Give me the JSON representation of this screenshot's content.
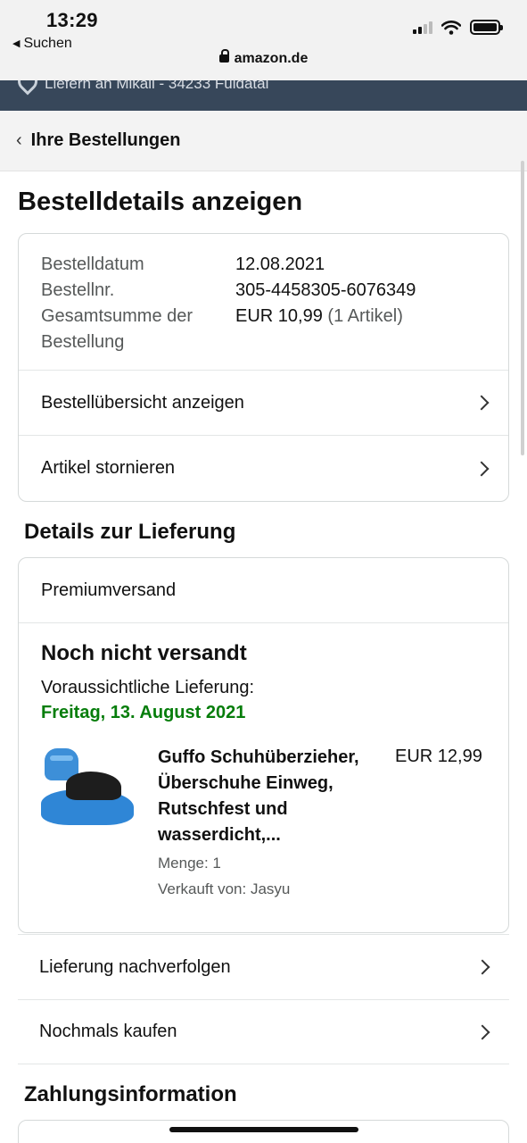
{
  "status_bar": {
    "time": "13:29",
    "back_label": "Suchen",
    "url": "amazon.de",
    "icons": [
      "cellular-signal-icon",
      "wifi-icon",
      "battery-icon",
      "lock-icon"
    ]
  },
  "deliver_strip": {
    "text": "Liefern an Mikail - 34233 Fuldatal",
    "icon": "location-pin-icon"
  },
  "breadcrumb": {
    "label": "Ihre Bestellungen"
  },
  "page_title": "Bestelldetails anzeigen",
  "order_info": {
    "date_label": "Bestelldatum",
    "date_value": "12.08.2021",
    "number_label": "Bestellnr.",
    "number_value": "305-4458305-6076349",
    "total_label_1": "Gesamtsumme der",
    "total_label_2": "Bestellung",
    "total_value": "EUR 10,99",
    "total_items": "(1 Artikel)"
  },
  "order_actions": {
    "summary": "Bestellübersicht anzeigen",
    "cancel": "Artikel stornieren"
  },
  "delivery": {
    "section_title": "Details zur Lieferung",
    "shipping_method": "Premiumversand",
    "status": "Noch nicht versandt",
    "expected_label": "Voraussichtliche Lieferung:",
    "expected_date": "Freitag, 13. August 2021",
    "item": {
      "name": "Guffo Schuhüberzieher, Überschuhe Einweg, Rutschfest und wasserdicht,...",
      "quantity": "Menge: 1",
      "seller": "Verkauft von: Jasyu",
      "price": "EUR 12,99"
    },
    "track": "Lieferung nachverfolgen",
    "buy_again": "Nochmals kaufen"
  },
  "payment": {
    "section_title": "Zahlungsinformation"
  },
  "colors": {
    "amazon_nav": "#37475a",
    "delivery_date": "#067d0b",
    "muted": "#565959"
  }
}
